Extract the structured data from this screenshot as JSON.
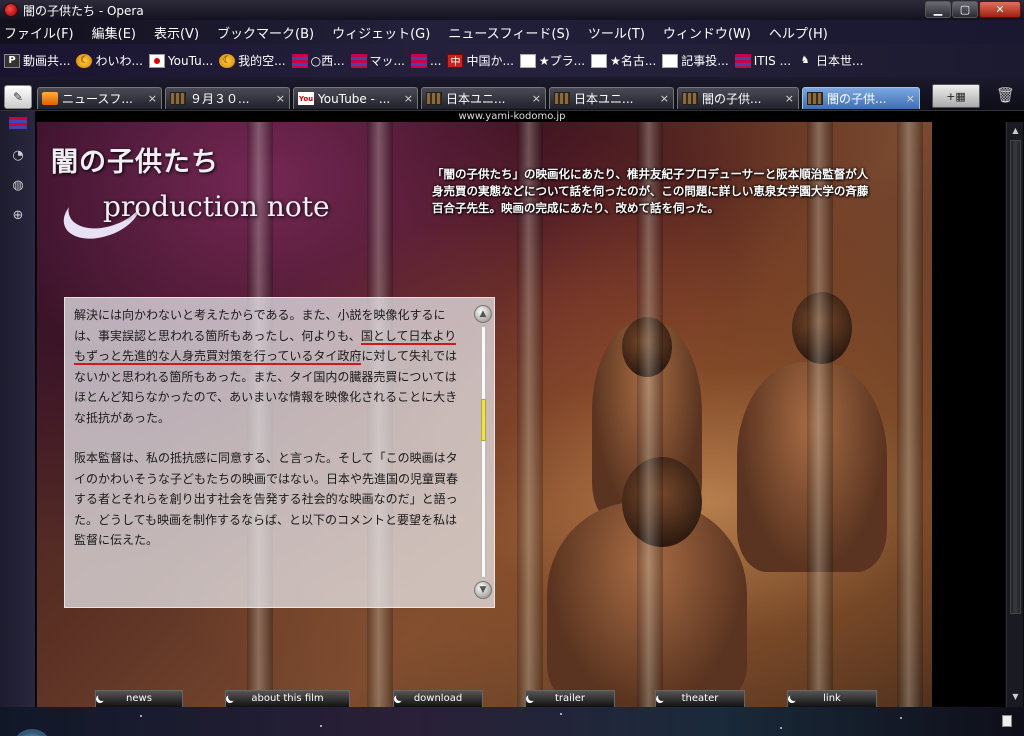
{
  "window": {
    "title": "闇の子供たち - Opera",
    "buttons": {
      "minimize": "▁",
      "maximize": "▢",
      "close": "✕"
    }
  },
  "menu": [
    "ファイル(F)",
    "編集(E)",
    "表示(V)",
    "ブックマーク(B)",
    "ウィジェット(G)",
    "ニュースフィード(S)",
    "ツール(T)",
    "ウィンドウ(W)",
    "ヘルプ(H)"
  ],
  "bookmarks": [
    {
      "icon": "p-icon",
      "label": "動画共..."
    },
    {
      "icon": "moon-icon",
      "label": "わいわ..."
    },
    {
      "icon": "japan-flag-icon",
      "label": "YouTu..."
    },
    {
      "icon": "moon-icon",
      "label": "我的空..."
    },
    {
      "icon": "bars-icon",
      "label": "○西..."
    },
    {
      "icon": "bars-icon",
      "label": "マッ..."
    },
    {
      "icon": "bars-icon",
      "label": "..."
    },
    {
      "icon": "red-icon",
      "label": "中国か..."
    },
    {
      "icon": "white-icon",
      "label": "★プラ..."
    },
    {
      "icon": "white-icon",
      "label": "★名古..."
    },
    {
      "icon": "white-icon",
      "label": "記事投..."
    },
    {
      "icon": "bars-icon",
      "label": "ITIS ..."
    },
    {
      "icon": "horse-icon",
      "label": "日本世..."
    }
  ],
  "tabs": [
    {
      "favicon": "rss",
      "label": "ニュースフ..."
    },
    {
      "favicon": "film",
      "label": "９月３０..."
    },
    {
      "favicon": "youtube",
      "label": "YouTube - ..."
    },
    {
      "favicon": "film",
      "label": "日本ユニ..."
    },
    {
      "favicon": "film",
      "label": "日本ユニ..."
    },
    {
      "favicon": "film",
      "label": "闇の子供..."
    },
    {
      "favicon": "film",
      "label": "闇の子供...",
      "active": true
    }
  ],
  "tab_close": "×",
  "url_hint": "www.yami-kodomo.jp",
  "page": {
    "logo_title": "闇の子供たち",
    "subtitle": "production note",
    "intro": "「闇の子供たち」の映画化にあたり、椎井友紀子プロデューサーと阪本順治監督が人身売買の実態などについて話を伺ったのが、この問題に詳しい恵泉女学園大学の斉藤百合子先生。映画の完成にあたり、改めて話を伺った。",
    "para1_a": "解決には向かわないと考えたからである。また、小説を映像化するには、事実誤認と思われる箇所もあったし、何よりも、",
    "para1_u": "国として日本よりもずっと先進的な人身売買対策を行っているタイ政府",
    "para1_b": "に対して失礼ではないかと思われる箇所もあった。また、タイ国内の臓器売買についてはほとんど知らなかったので、あいまいな情報を映像化されることに大きな抵抗があった。",
    "para2": "阪本監督は、私の抵抗感に同意する、と言った。そして「この映画はタイのかわいそうな子どもたちの映画ではない。日本や先進国の児童買春する者とそれらを創り出す社会を告発する社会的な映画なのだ」と語った。どうしても映画を制作するならば、と以下のコメントと要望を私は監督に伝えた。",
    "nav": [
      "news",
      "about this film",
      "download",
      "trailer",
      "theater",
      "link"
    ]
  }
}
